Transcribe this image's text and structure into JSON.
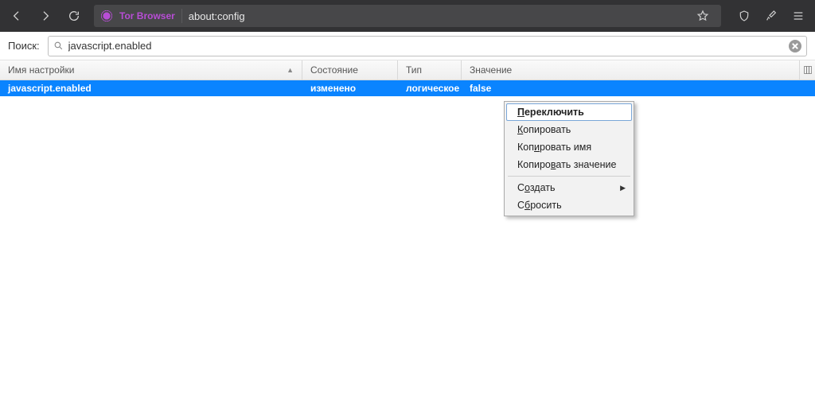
{
  "chrome": {
    "brand": "Tor Browser",
    "url": "about:config"
  },
  "search": {
    "label": "Поиск:",
    "value": "javascript.enabled"
  },
  "columns": {
    "name": "Имя настройки",
    "state": "Состояние",
    "type": "Тип",
    "value": "Значение"
  },
  "row": {
    "name": "javascript.enabled",
    "state": "изменено",
    "type": "логическое",
    "value": "false"
  },
  "menu": {
    "toggle": "Переключить",
    "copy": "Копировать",
    "copy_name": "Копировать имя",
    "copy_value": "Копировать значение",
    "create": "Создать",
    "reset": "Сбросить"
  }
}
